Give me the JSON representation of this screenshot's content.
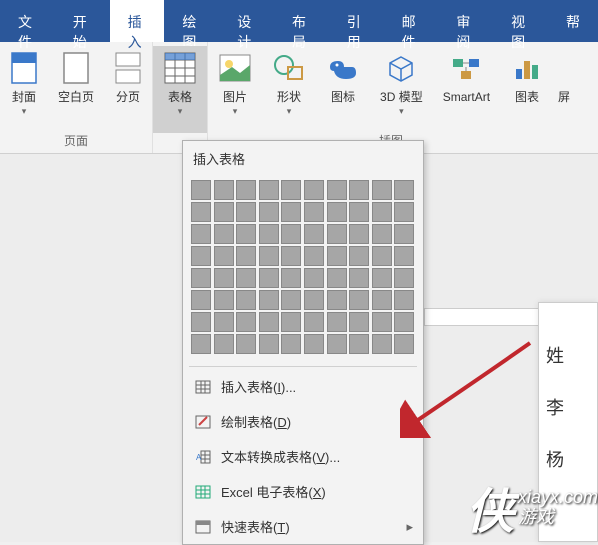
{
  "tabs": [
    "文件",
    "开始",
    "插入",
    "绘图",
    "设计",
    "布局",
    "引用",
    "邮件",
    "审阅",
    "视图",
    "帮"
  ],
  "ribbon_groups": {
    "pages": {
      "label": "页面",
      "items": [
        "封面",
        "空白页",
        "分页"
      ]
    },
    "table": {
      "label": "表格"
    },
    "illustrations": {
      "label": "插图",
      "items": [
        "图片",
        "形状",
        "图标",
        "3D 模型",
        "SmartArt",
        "图表",
        "屏"
      ]
    }
  },
  "dropdown": {
    "title": "插入表格",
    "menu": [
      {
        "label": "插入表格",
        "key": "I",
        "suffix": "..."
      },
      {
        "label": "绘制表格",
        "key": "D",
        "suffix": ""
      },
      {
        "label": "文本转换成表格",
        "key": "V",
        "suffix": "..."
      },
      {
        "label": "Excel 电子表格",
        "key": "X",
        "suffix": ""
      },
      {
        "label": "快速表格",
        "key": "T",
        "suffix": "",
        "arrow": true
      }
    ]
  },
  "document_text": [
    "姓",
    "李",
    "杨"
  ],
  "watermark": {
    "site": "xiayx.com",
    "name": "游戏"
  }
}
